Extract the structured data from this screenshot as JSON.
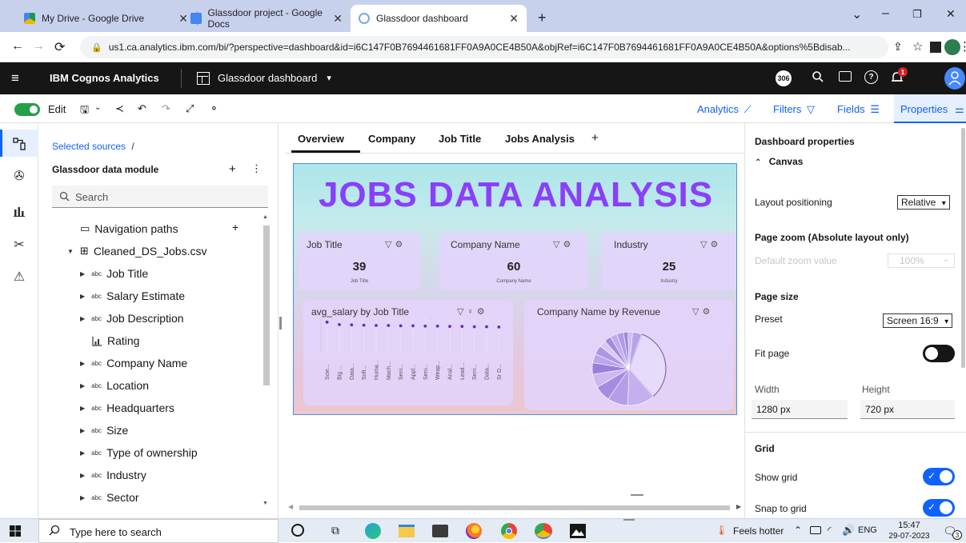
{
  "browser": {
    "tabs": [
      {
        "label": "My Drive - Google Drive",
        "close": "✕"
      },
      {
        "label": "Glassdoor project - Google Docs",
        "close": "✕"
      },
      {
        "label": "Glassdoor dashboard",
        "close": "✕"
      }
    ],
    "new_tab": "+",
    "url": "us1.ca.analytics.ibm.com/bi/?perspective=dashboard&id=i6C147F0B7694461681FF0A9A0CE4B50A&objRef=i6C147F0B7694461681FF0A9A0CE4B50A&options%5Bdisab..."
  },
  "app": {
    "product": "IBM Cognos Analytics",
    "dashboard_title": "Glassdoor dashboard",
    "notification_count": "306",
    "alert_badge": "1"
  },
  "toolbar": {
    "edit_label": "Edit",
    "analytics": "Analytics",
    "filters": "Filters",
    "fields": "Fields",
    "properties": "Properties"
  },
  "sources": {
    "breadcrumb": "Selected sources",
    "breadcrumb_sep": "/",
    "module": "Glassdoor data module",
    "search_placeholder": "Search",
    "navigation_paths": "Navigation paths",
    "file": "Cleaned_DS_Jobs.csv",
    "abc": "abc",
    "fields": [
      "Job Title",
      "Salary Estimate",
      "Job Description",
      "Rating",
      "Company Name",
      "Location",
      "Headquarters",
      "Size",
      "Type of ownership",
      "Industry",
      "Sector"
    ]
  },
  "canvas_tabs": [
    "Overview",
    "Company",
    "Job Title",
    "Jobs Analysis"
  ],
  "canvas_add": "+",
  "dashboard": {
    "banner": "JOBS DATA ANALYSIS",
    "kpis": [
      {
        "title": "Job Title",
        "value": "39",
        "sub": "Job Title"
      },
      {
        "title": "Company Name",
        "value": "60",
        "sub": "Company Name"
      },
      {
        "title": "Industry",
        "value": "25",
        "sub": "Industry"
      }
    ],
    "scatter_title": "avg_salary by Job Title",
    "pie_title": "Company Name by Revenue"
  },
  "chart_data": [
    {
      "type": "scatter",
      "title": "avg_salary by Job Title",
      "categories": [
        "Scie...",
        "Big ...",
        "Data...",
        "Soft...",
        "Huma...",
        "Mach...",
        "Seni...",
        "Appl...",
        "Seni...",
        "Weap...",
        "Anal...",
        "Lead...",
        "Seni...",
        "Data...",
        "Sr D..."
      ],
      "values": [
        100,
        92,
        91,
        90,
        89,
        89,
        88,
        88,
        87,
        87,
        86,
        86,
        85,
        85,
        84
      ],
      "ylim": [
        0,
        110
      ]
    },
    {
      "type": "pie",
      "title": "Company Name by Revenue",
      "values": [
        33,
        12,
        9,
        7,
        6,
        5,
        4,
        4,
        3,
        3,
        3,
        3,
        2,
        2,
        4
      ]
    }
  ],
  "properties": {
    "title": "Dashboard properties",
    "canvas_section": "Canvas",
    "layout_positioning_label": "Layout positioning",
    "layout_positioning_value": "Relative",
    "page_zoom_label": "Page zoom (Absolute layout only)",
    "default_zoom_label": "Default zoom value",
    "default_zoom_value": "100%",
    "page_size": "Page size",
    "preset_label": "Preset",
    "preset_value": "Screen 16:9",
    "fit_page": "Fit page",
    "width_label": "Width",
    "height_label": "Height",
    "width_value": "1280 px",
    "height_value": "720 px",
    "grid": "Grid",
    "show_grid": "Show grid",
    "snap_to_grid": "Snap to grid"
  },
  "taskbar": {
    "search_placeholder": "Type here to search",
    "weather": "Feels hotter",
    "lang": "ENG",
    "time": "15:47",
    "date": "29-07-2023",
    "notif": "3"
  },
  "colors": {
    "accent": "#0f62fe",
    "header_bg": "#161616",
    "banner_text": "#8a3ffc",
    "card_bg": "#e2d4fa",
    "toggle_on": "#0f62fe",
    "point": "#6929c4"
  }
}
